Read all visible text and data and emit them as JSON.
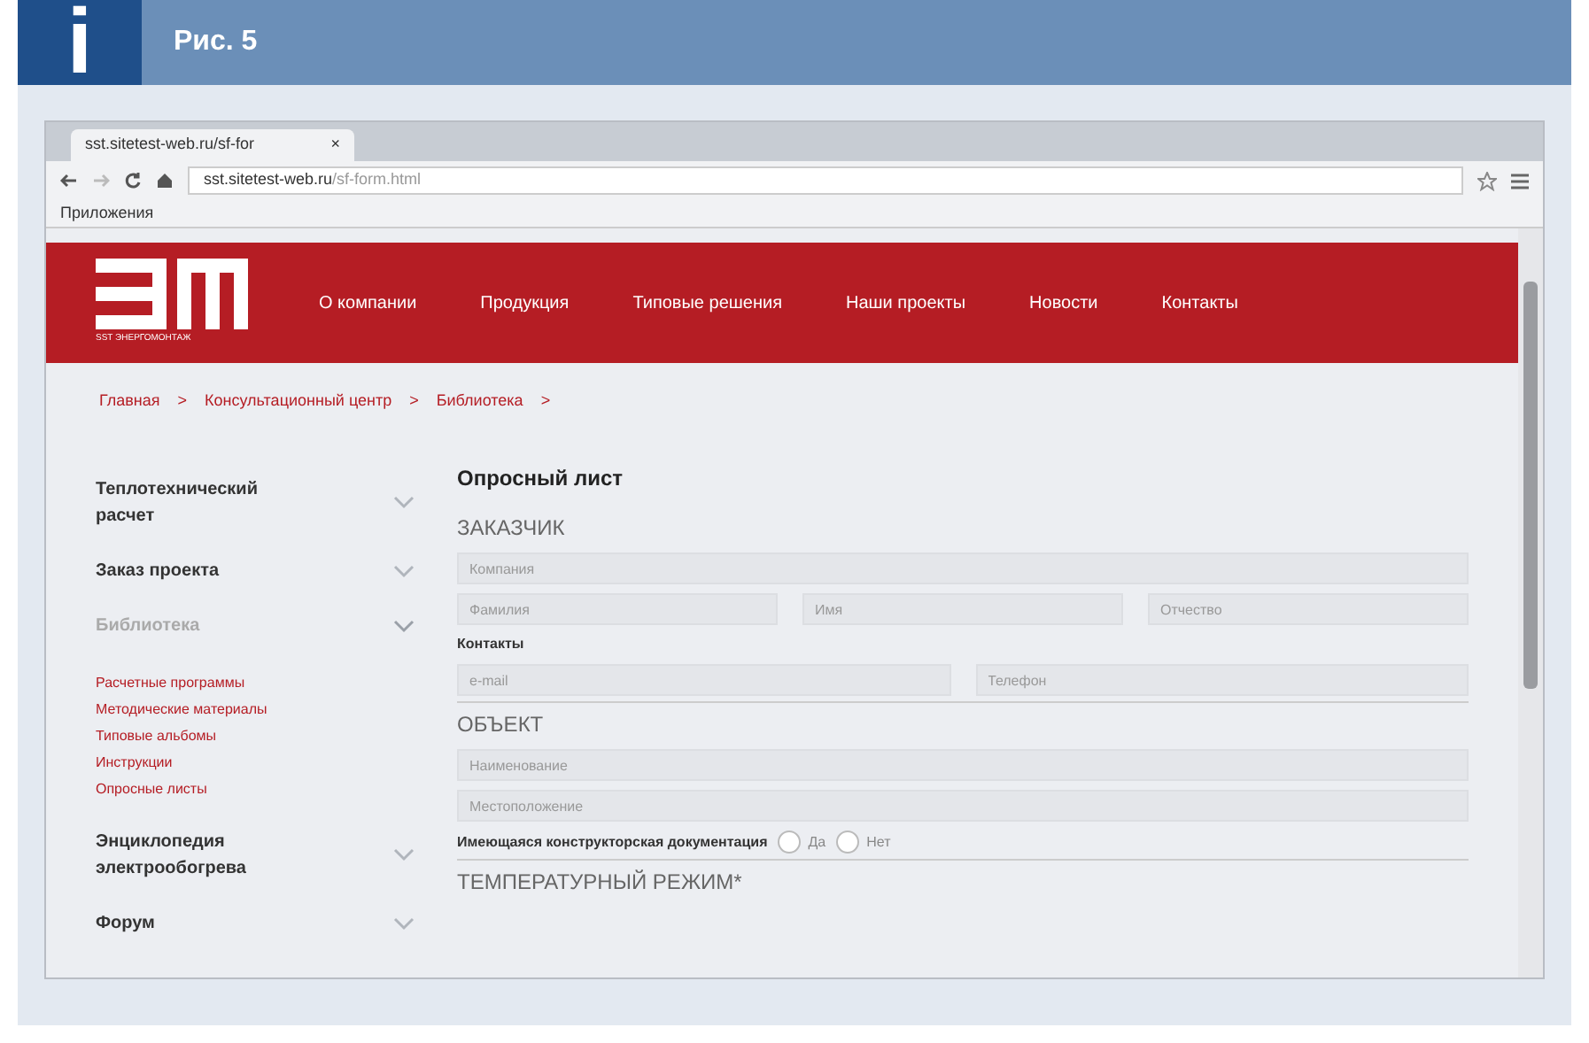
{
  "figure": {
    "icon": "i",
    "caption": "Рис. 5"
  },
  "browser": {
    "tab": {
      "title": "sst.sitetest-web.ru/sf-for",
      "close": "×"
    },
    "url_host": "sst.sitetest-web.ru",
    "url_path": "/sf-form.html",
    "bookmarks": [
      "Приложения"
    ]
  },
  "site": {
    "logo_caption": "SST ЭНЕРГОМОНТАЖ",
    "nav": [
      "О компании",
      "Продукция",
      "Типовые решения",
      "Наши проекты",
      "Новости",
      "Контакты"
    ],
    "breadcrumbs": [
      {
        "label": "Главная",
        "separator": ">"
      },
      {
        "label": "Консультационный центр",
        "separator": ">"
      },
      {
        "label": "Библиотека",
        "separator": ">"
      }
    ],
    "sidebar": [
      {
        "label": "Теплотехнический расчет",
        "expanded": false
      },
      {
        "label": "Заказ проекта",
        "expanded": false
      },
      {
        "label": "Библиотека",
        "expanded": true,
        "children": [
          "Расчетные программы",
          "Методические материалы",
          "Типовые альбомы",
          "Инструкции",
          "Опросные листы"
        ]
      },
      {
        "label": "Энциклопедия электрообогрева",
        "expanded": false
      },
      {
        "label": "Форум",
        "expanded": false
      }
    ],
    "form": {
      "title": "Опросный лист",
      "sections": [
        {
          "heading": "ЗАКАЗЧИК",
          "rows": [
            {
              "kind": "fields",
              "fields": [
                {
                  "placeholder": "Компания"
                }
              ]
            },
            {
              "kind": "fields",
              "fields": [
                {
                  "placeholder": "Фамилия"
                },
                {
                  "placeholder": "Имя"
                },
                {
                  "placeholder": "Отчество"
                }
              ]
            },
            {
              "kind": "label",
              "text": "Контакты"
            },
            {
              "kind": "fields",
              "fields": [
                {
                  "placeholder": "e-mail"
                },
                {
                  "placeholder": "Телефон"
                }
              ]
            }
          ]
        },
        {
          "heading": "ОБЪЕКТ",
          "rows": [
            {
              "kind": "fields",
              "fields": [
                {
                  "placeholder": "Наименование"
                }
              ]
            },
            {
              "kind": "fields",
              "fields": [
                {
                  "placeholder": "Местоположение"
                }
              ]
            },
            {
              "kind": "radio",
              "text": "Имеющаяся конструкторская документация",
              "options": [
                {
                  "label": "Да",
                  "selected": false
                },
                {
                  "label": "Нет",
                  "selected": false
                }
              ]
            }
          ]
        },
        {
          "heading": "ТЕМПЕРАТУРНЫЙ РЕЖИМ*"
        }
      ]
    }
  }
}
